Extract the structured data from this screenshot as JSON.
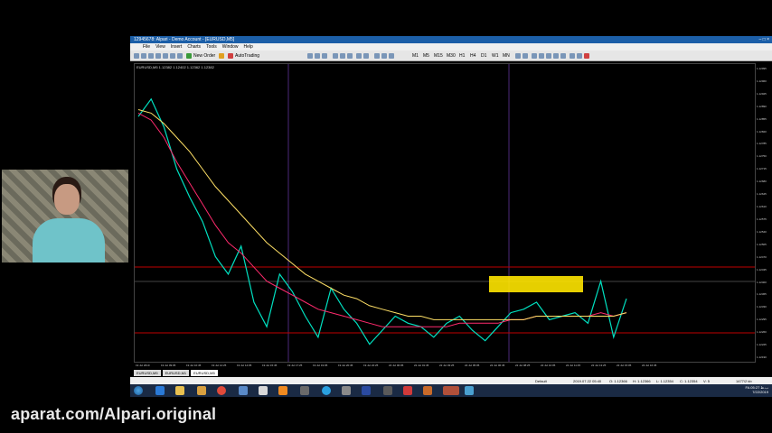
{
  "window": {
    "title": "12945678: Alpari - Demo Account - [EURUSD,M5]",
    "controls": [
      "–",
      "□",
      "×"
    ]
  },
  "menu": [
    "File",
    "View",
    "Insert",
    "Charts",
    "Tools",
    "Window",
    "Help"
  ],
  "toolbar": {
    "new_order": "New Order",
    "auto_trading": "AutoTrading",
    "timeframes": [
      "M1",
      "M5",
      "M15",
      "M30",
      "H1",
      "H4",
      "D1",
      "W1",
      "MN"
    ]
  },
  "chart": {
    "title": "EURUSD,M5  1.12382 1.12402 1.12362 1.12382",
    "price_ticks": [
      "1.12995",
      "1.12960",
      "1.12925",
      "1.12890",
      "1.12855",
      "1.12820",
      "1.12785",
      "1.12750",
      "1.12715",
      "1.12680",
      "1.12645",
      "1.12610",
      "1.12575",
      "1.12540",
      "1.12505",
      "1.12470",
      "1.12435",
      "1.12400",
      "1.12365",
      "1.12330",
      "1.12295",
      "1.12260",
      "1.12225",
      "1.12190"
    ],
    "time_ticks": [
      "19 Jul 2019",
      "19 Jul 09:05",
      "19 Jul 10:45",
      "19 Jul 12:25",
      "19 Jul 14:05",
      "19 Jul 15:45",
      "19 Jul 17:25",
      "19 Jul 19:05",
      "19 Jul 20:45",
      "19 Jul 22:25",
      "22 Jul 00:05",
      "22 Jul 01:45",
      "22 Jul 03:25",
      "22 Jul 05:05",
      "22 Jul 06:45",
      "22 Jul 08:25",
      "22 Jul 10:05",
      "22 Jul 11:45",
      "22 Jul 13:25",
      "22 Jul 15:05",
      "22 Jul 16:45"
    ],
    "colors": {
      "price": "#00e0c0",
      "ma_fast": "#ff2a6d",
      "ma_slow": "#ffe066",
      "highlight": "#ffe600",
      "level_line": "#c00000",
      "separator": "#4b2a7a"
    }
  },
  "chart_data": {
    "type": "line",
    "x_unit": "bar index (M5)",
    "series": [
      {
        "name": "EURUSD",
        "values": [
          1.1285,
          1.129,
          1.1282,
          1.127,
          1.1262,
          1.1255,
          1.1245,
          1.124,
          1.1248,
          1.1232,
          1.1225,
          1.124,
          1.1235,
          1.1228,
          1.1222,
          1.1236,
          1.123,
          1.1226,
          1.122,
          1.1224,
          1.1228,
          1.1226,
          1.1225,
          1.1222,
          1.1226,
          1.1228,
          1.1224,
          1.1221,
          1.1225,
          1.1229,
          1.123,
          1.1232,
          1.1227,
          1.1228,
          1.1229,
          1.1226,
          1.1238,
          1.1222,
          1.1233
        ]
      },
      {
        "values": [
          1.1286,
          1.1284,
          1.1279,
          1.1272,
          1.1266,
          1.126,
          1.1254,
          1.1249,
          1.1246,
          1.1242,
          1.1238,
          1.1236,
          1.1234,
          1.1232,
          1.123,
          1.1229,
          1.1228,
          1.1227,
          1.1226,
          1.1225,
          1.1225,
          1.1225,
          1.1225,
          1.1225,
          1.1225,
          1.1226,
          1.1226,
          1.1226,
          1.1226,
          1.1227,
          1.1227,
          1.1228,
          1.1228,
          1.1228,
          1.1228,
          1.1228,
          1.1229,
          1.1228,
          1.1229
        ]
      },
      {
        "values": [
          1.1287,
          1.1286,
          1.1283,
          1.1279,
          1.1275,
          1.127,
          1.1265,
          1.1261,
          1.1257,
          1.1253,
          1.1249,
          1.1246,
          1.1243,
          1.124,
          1.1238,
          1.1236,
          1.1234,
          1.1233,
          1.1231,
          1.123,
          1.1229,
          1.1228,
          1.1228,
          1.1227,
          1.1227,
          1.1227,
          1.1227,
          1.1227,
          1.1227,
          1.1227,
          1.1227,
          1.1228,
          1.1228,
          1.1228,
          1.1228,
          1.1228,
          1.1228,
          1.1228,
          1.1229
        ]
      }
    ],
    "ylim": [
      1.1215,
      1.13
    ],
    "grid": false
  },
  "tabs": [
    "EURUSD,M5",
    "EURUSD,M1",
    "EURUSD,M5"
  ],
  "status": {
    "profile": "Default",
    "datetime": "2019.07.22 05:40",
    "o": "O: 1.12366",
    "h": "H: 1.12366",
    "l": "L: 1.12354",
    "c": "C: 1.12354",
    "v": "V: 5",
    "traffic": "1477/2 kb"
  },
  "clock": {
    "time": "05:27 ب.ظ",
    "date": "7/22/2019",
    "lang": "FA"
  },
  "watermark": "aparat.com/Alpari.original"
}
